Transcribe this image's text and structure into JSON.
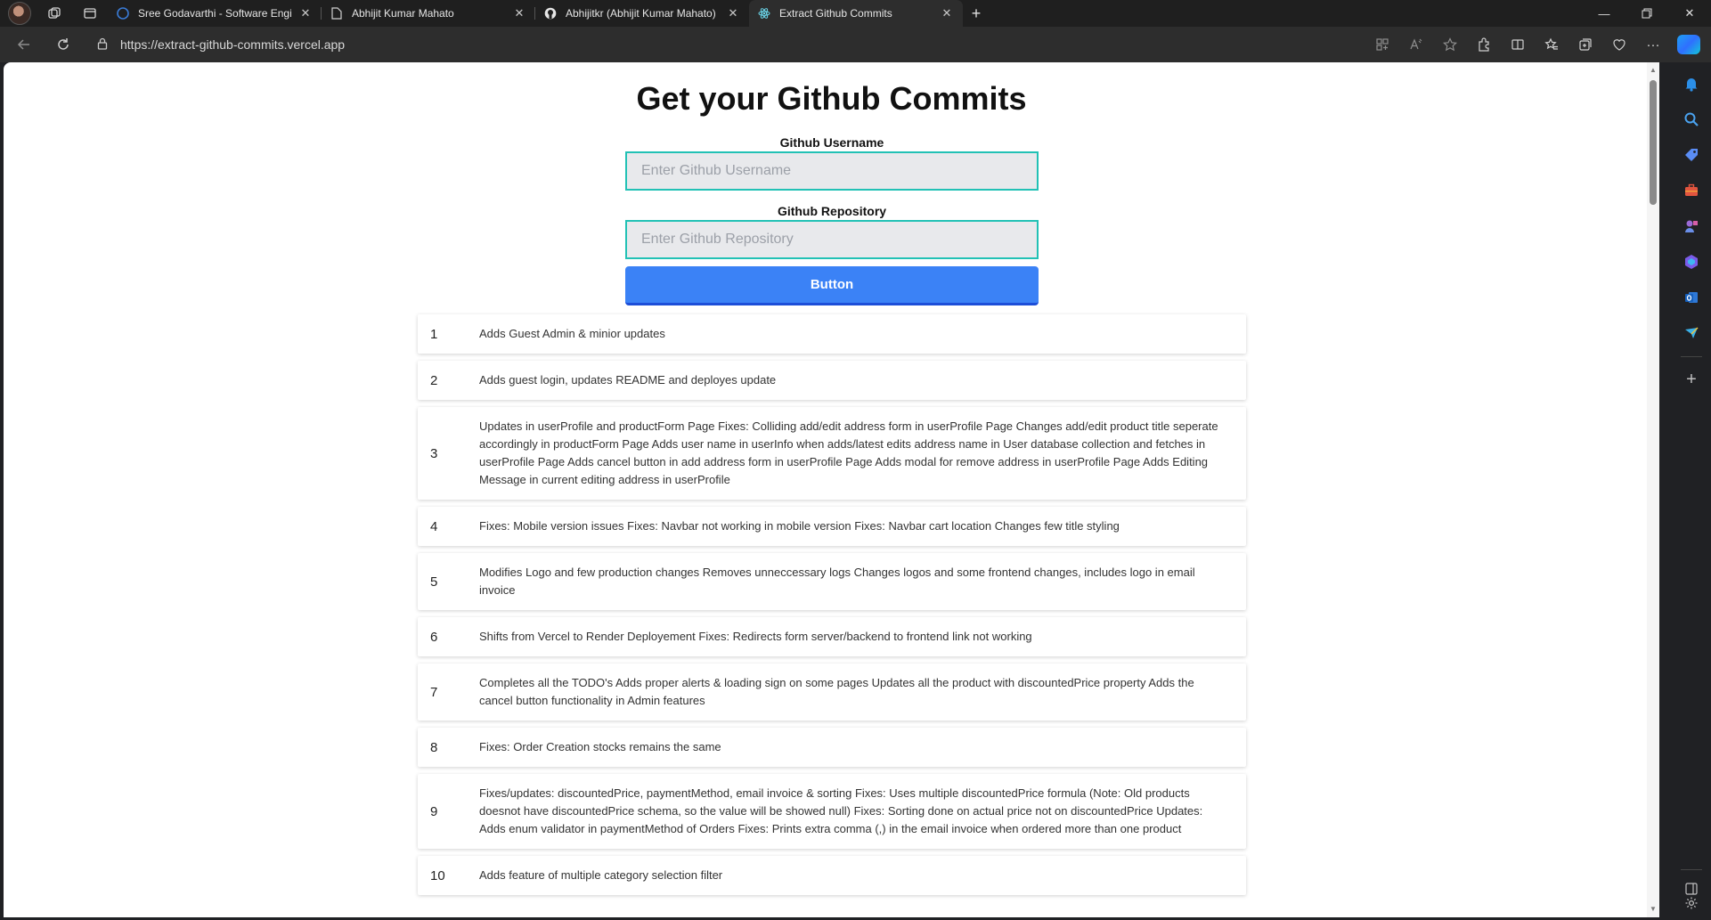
{
  "browser": {
    "tabs": [
      {
        "title": "Sree Godavarthi - Software Engi",
        "icon": "linkedin-icon",
        "active": false
      },
      {
        "title": "Abhijit Kumar Mahato",
        "icon": "document-icon",
        "active": false
      },
      {
        "title": "Abhijitkr (Abhijit Kumar Mahato)",
        "icon": "github-icon",
        "active": false
      },
      {
        "title": "Extract Github Commits",
        "icon": "react-icon",
        "active": true
      }
    ],
    "url": "https://extract-github-commits.vercel.app"
  },
  "page": {
    "title": "Get your Github Commits",
    "username_label": "Github Username",
    "username_placeholder": "Enter Github Username",
    "username_value": "",
    "repo_label": "Github Repository",
    "repo_placeholder": "Enter Github Repository",
    "repo_value": "",
    "button_label": "Button"
  },
  "commits": [
    {
      "n": "1",
      "msg": "Adds Guest Admin & minior updates"
    },
    {
      "n": "2",
      "msg": "Adds guest login, updates README and deployes update"
    },
    {
      "n": "3",
      "msg": "Updates in userProfile and productForm Page Fixes: Colliding add/edit address form in userProfile Page Changes add/edit product title seperate accordingly in productForm Page Adds user name in userInfo when adds/latest edits address name in User database collection and fetches in userProfile Page Adds cancel button in add address form in userProfile Page Adds modal for remove address in userProfile Page Adds Editing Message in current editing address in userProfile"
    },
    {
      "n": "4",
      "msg": "Fixes: Mobile version issues Fixes: Navbar not working in mobile version Fixes: Navbar cart location Changes few title styling"
    },
    {
      "n": "5",
      "msg": "Modifies Logo and few production changes Removes unneccessary logs Changes logos and some frontend changes, includes logo in email invoice"
    },
    {
      "n": "6",
      "msg": "Shifts from Vercel to Render Deployement Fixes: Redirects form server/backend to frontend link not working"
    },
    {
      "n": "7",
      "msg": "Completes all the TODO's Adds proper alerts & loading sign on some pages Updates all the product with discountedPrice property Adds the cancel button functionality in Admin features"
    },
    {
      "n": "8",
      "msg": "Fixes: Order Creation stocks remains the same"
    },
    {
      "n": "9",
      "msg": "Fixes/updates: discountedPrice, paymentMethod, email invoice & sorting Fixes: Uses multiple discountedPrice formula (Note: Old products doesnot have discountedPrice schema, so the value will be showed null) Fixes: Sorting done on actual price not on discountedPrice Updates: Adds enum validator in paymentMethod of Orders Fixes: Prints extra comma (,) in the email invoice when ordered more than one product"
    },
    {
      "n": "10",
      "msg": "Adds feature of multiple category selection filter"
    }
  ],
  "colors": {
    "input_border": "#22c1b5",
    "button_bg": "#3b82f6"
  }
}
